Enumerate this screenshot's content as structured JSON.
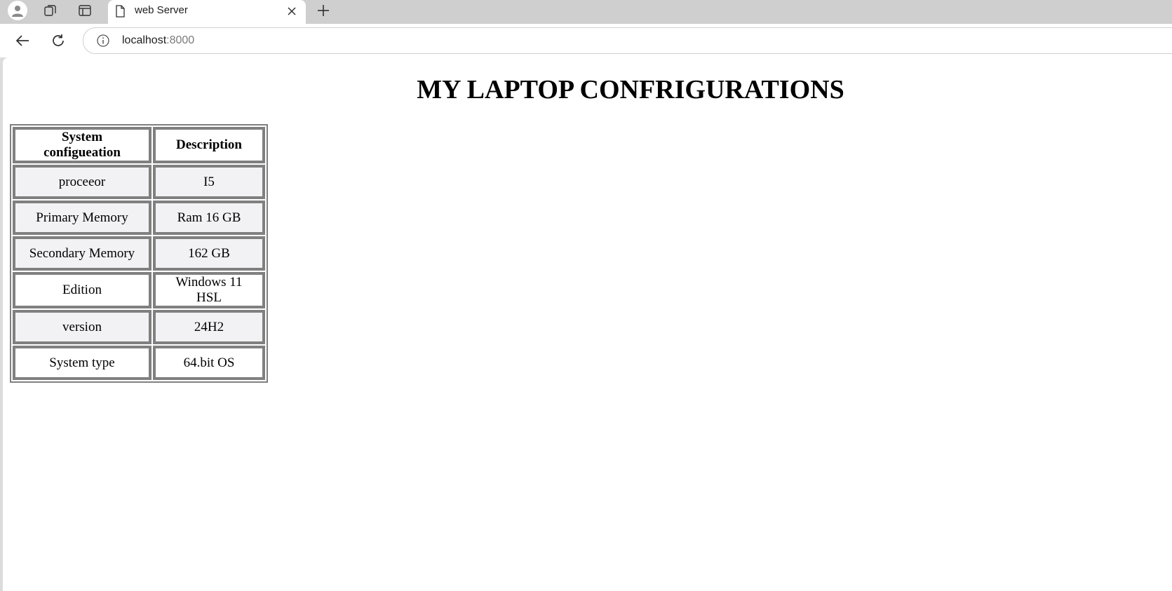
{
  "browser": {
    "tab": {
      "title": "web Server",
      "icon": "document-icon"
    },
    "address": {
      "host": "localhost",
      "port": ":8000"
    }
  },
  "page": {
    "title": "MY LAPTOP CONFRIGURATIONS",
    "table": {
      "headers": [
        "System configueation",
        "Description"
      ],
      "rows": [
        [
          "proceeor",
          "I5"
        ],
        [
          "Primary Memory",
          "Ram 16 GB"
        ],
        [
          "Secondary Memory",
          "162 GB"
        ],
        [
          "Edition",
          "Windows 11 HSL"
        ],
        [
          "version",
          "24H2"
        ],
        [
          "System type",
          "64.bit OS"
        ]
      ]
    }
  },
  "colors": {
    "tabstrip": "#cfcfcf",
    "table_border": "#808080",
    "row_shade": "#f2f2f4"
  }
}
